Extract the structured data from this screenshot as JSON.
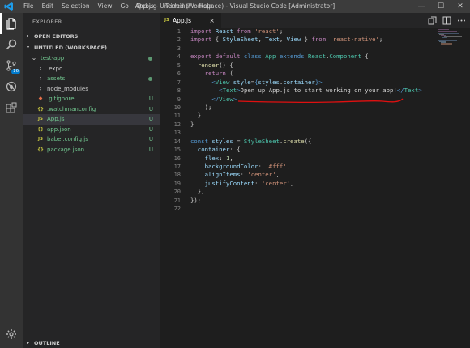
{
  "titlebar": {
    "menu": [
      "File",
      "Edit",
      "Selection",
      "View",
      "Go",
      "Debug",
      "Terminal",
      "Help"
    ],
    "title": "App.js - Untitled (Workspace) - Visual Studio Code [Administrator]"
  },
  "activity": {
    "scm_badge": "16"
  },
  "sidebar": {
    "header": "EXPLORER",
    "open_editors": "OPEN EDITORS",
    "workspace": "UNTITLED (WORKSPACE)",
    "outline": "OUTLINE",
    "items": [
      {
        "label": "test-app",
        "icon": "⌄",
        "status": "dot",
        "color": "#73c991"
      },
      {
        "label": ".expo",
        "icon": "›",
        "status": "",
        "color": "#cccccc"
      },
      {
        "label": "assets",
        "icon": "›",
        "status": "dot",
        "color": "#73c991"
      },
      {
        "label": "node_modules",
        "icon": "›",
        "status": "",
        "color": "#cccccc"
      },
      {
        "label": ".gitignore",
        "icon": "◆",
        "status": "U",
        "color": "#73c991"
      },
      {
        "label": ".watchmanconfig",
        "icon": "{}",
        "status": "U",
        "color": "#73c991"
      },
      {
        "label": "App.js",
        "icon": "JS",
        "status": "U",
        "color": "#73c991"
      },
      {
        "label": "app.json",
        "icon": "{}",
        "status": "U",
        "color": "#73c991"
      },
      {
        "label": "babel.config.js",
        "icon": "JS",
        "status": "U",
        "color": "#73c991"
      },
      {
        "label": "package.json",
        "icon": "{}",
        "status": "U",
        "color": "#73c991"
      }
    ]
  },
  "tab": {
    "badge": "JS",
    "label": "App.js",
    "close": "×"
  },
  "editor": {
    "line_numbers": [
      "1",
      "2",
      "3",
      "4",
      "5",
      "6",
      "7",
      "8",
      "9",
      "10",
      "11",
      "12",
      "13",
      "14",
      "15",
      "16",
      "17",
      "18",
      "19",
      "20",
      "21",
      "22"
    ],
    "lines": [
      [
        [
          "kw",
          "import "
        ],
        [
          "var",
          "React "
        ],
        [
          "kw",
          "from "
        ],
        [
          "str",
          "'react'"
        ],
        [
          "punc",
          ";"
        ]
      ],
      [
        [
          "kw",
          "import "
        ],
        [
          "punc",
          "{ "
        ],
        [
          "var",
          "StyleSheet"
        ],
        [
          "punc",
          ", "
        ],
        [
          "var",
          "Text"
        ],
        [
          "punc",
          ", "
        ],
        [
          "var",
          "View "
        ],
        [
          "punc",
          "} "
        ],
        [
          "kw",
          "from "
        ],
        [
          "str",
          "'react-native'"
        ],
        [
          "punc",
          ";"
        ]
      ],
      [],
      [
        [
          "kw",
          "export default "
        ],
        [
          "kb",
          "class "
        ],
        [
          "cls",
          "App "
        ],
        [
          "kb",
          "extends "
        ],
        [
          "cls",
          "React"
        ],
        [
          "punc",
          "."
        ],
        [
          "cls",
          "Component "
        ],
        [
          "punc",
          "{"
        ]
      ],
      [
        [
          "punc",
          "  "
        ],
        [
          "fn",
          "render"
        ],
        [
          "punc",
          "() {"
        ]
      ],
      [
        [
          "punc",
          "    "
        ],
        [
          "kw",
          "return "
        ],
        [
          "punc",
          "("
        ]
      ],
      [
        [
          "punc",
          "      "
        ],
        [
          "tag",
          "<"
        ],
        [
          "cls",
          "View "
        ],
        [
          "var",
          "style"
        ],
        [
          "punc",
          "="
        ],
        [
          "kb",
          "{"
        ],
        [
          "var",
          "styles"
        ],
        [
          "punc",
          "."
        ],
        [
          "var",
          "container"
        ],
        [
          "kb",
          "}"
        ],
        [
          "tag",
          ">"
        ]
      ],
      [
        [
          "punc",
          "        "
        ],
        [
          "tag",
          "<"
        ],
        [
          "cls",
          "Text"
        ],
        [
          "tag",
          ">"
        ],
        [
          "jtext",
          "Open up App.js to start working on your app!"
        ],
        [
          "tag",
          "</"
        ],
        [
          "cls",
          "Text"
        ],
        [
          "tag",
          ">"
        ]
      ],
      [
        [
          "punc",
          "      "
        ],
        [
          "tag",
          "</"
        ],
        [
          "cls",
          "View"
        ],
        [
          "tag",
          ">"
        ]
      ],
      [
        [
          "punc",
          "    );"
        ]
      ],
      [
        [
          "punc",
          "  }"
        ]
      ],
      [
        [
          "punc",
          "}"
        ]
      ],
      [],
      [
        [
          "kb",
          "const "
        ],
        [
          "var",
          "styles "
        ],
        [
          "punc",
          "= "
        ],
        [
          "cls",
          "StyleSheet"
        ],
        [
          "punc",
          "."
        ],
        [
          "fn",
          "create"
        ],
        [
          "punc",
          "({"
        ]
      ],
      [
        [
          "punc",
          "  "
        ],
        [
          "var",
          "container"
        ],
        [
          "punc",
          ": {"
        ]
      ],
      [
        [
          "punc",
          "    "
        ],
        [
          "var",
          "flex"
        ],
        [
          "punc",
          ": "
        ],
        [
          "num",
          "1"
        ],
        [
          "punc",
          ","
        ]
      ],
      [
        [
          "punc",
          "    "
        ],
        [
          "var",
          "backgroundColor"
        ],
        [
          "punc",
          ": "
        ],
        [
          "str",
          "'#fff'"
        ],
        [
          "punc",
          ","
        ]
      ],
      [
        [
          "punc",
          "    "
        ],
        [
          "var",
          "alignItems"
        ],
        [
          "punc",
          ": "
        ],
        [
          "str",
          "'center'"
        ],
        [
          "punc",
          ","
        ]
      ],
      [
        [
          "punc",
          "    "
        ],
        [
          "var",
          "justifyContent"
        ],
        [
          "punc",
          ": "
        ],
        [
          "str",
          "'center'"
        ],
        [
          "punc",
          ","
        ]
      ],
      [
        [
          "punc",
          "  },"
        ]
      ],
      [
        [
          "punc",
          "});"
        ]
      ],
      []
    ]
  },
  "colors": {
    "annotation_underline": "#e01010",
    "accent": "#007acc"
  }
}
